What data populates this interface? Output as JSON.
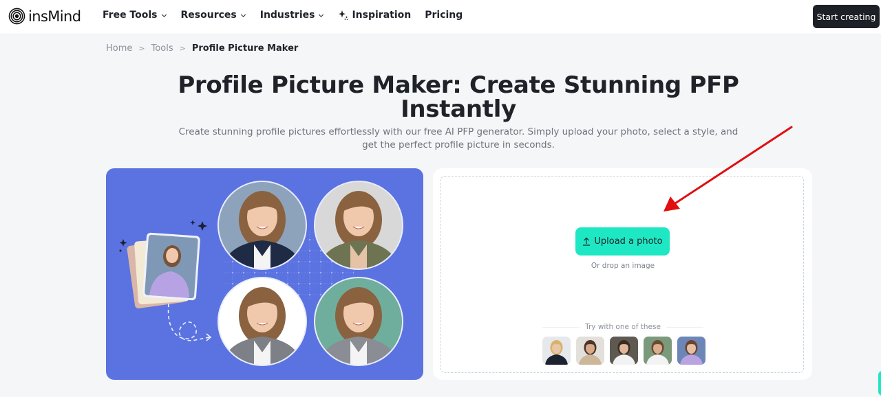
{
  "nav": {
    "brand": "insMind",
    "menu": [
      {
        "label": "Free Tools",
        "has_dropdown": true
      },
      {
        "label": "Resources",
        "has_dropdown": true
      },
      {
        "label": "Industries",
        "has_dropdown": true
      },
      {
        "label": "Inspiration",
        "has_dropdown": false,
        "icon": "sparkle-icon"
      },
      {
        "label": "Pricing",
        "has_dropdown": false
      }
    ],
    "cta": "Start creating"
  },
  "breadcrumb": {
    "items": [
      "Home",
      "Tools",
      "Profile Picture Maker"
    ],
    "separator": ">"
  },
  "hero": {
    "title": "Profile Picture Maker: Create Stunning PFP Instantly",
    "subtitle": "Create stunning profile pictures effortlessly with our free AI PFP generator. Simply upload your photo, select a style, and get the perfect profile picture in seconds."
  },
  "illustration": {
    "description": "Original photo transformed into four profile picture styles",
    "source_photo": "woman-purple-sweater",
    "results": [
      "navy-blazer-blue-bg",
      "olive-blazer-grey-bg",
      "grey-blazer-white-bg",
      "grey-suit-tie-green-bg"
    ]
  },
  "upload": {
    "button_label": "Upload a photo",
    "drop_hint": "Or drop an image",
    "try_label": "Try with one of these",
    "samples": [
      {
        "name": "sample-woman-blazer",
        "bg": "#e6e8ec",
        "skin": "#e8c6a8",
        "hair": "#d9b26a",
        "cloth": "#1c2230"
      },
      {
        "name": "sample-man-beige",
        "bg": "#e3e0dc",
        "skin": "#d8a98a",
        "hair": "#4a362a",
        "cloth": "#cdb79a"
      },
      {
        "name": "sample-woman-white",
        "bg": "#5e5a52",
        "skin": "#e0b79a",
        "hair": "#3a2a20",
        "cloth": "#f2f2f2"
      },
      {
        "name": "sample-man-outdoor",
        "bg": "#7b9a7c",
        "skin": "#dcae90",
        "hair": "#6b4a30",
        "cloth": "#f3f3f3"
      },
      {
        "name": "sample-woman-lavender",
        "bg": "#6c86b8",
        "skin": "#e6c0a4",
        "hair": "#6b4430",
        "cloth": "#b9a3e0"
      }
    ]
  },
  "colors": {
    "accent": "#1ee8c3",
    "hero_bg": "#5b73e0",
    "dark_button": "#1d2026",
    "annotation_arrow": "#e01010"
  }
}
